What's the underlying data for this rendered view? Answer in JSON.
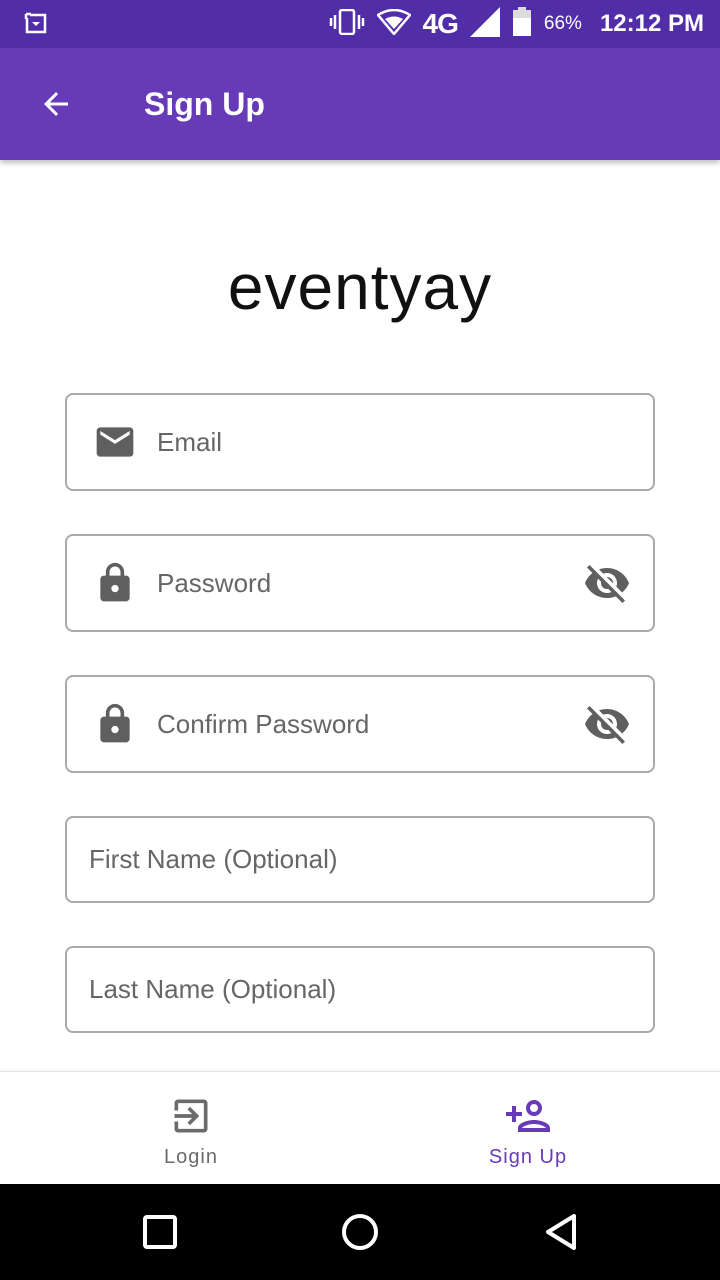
{
  "status_bar": {
    "network": "4G",
    "battery": "66%",
    "time": "12:12 PM"
  },
  "app_bar": {
    "title": "Sign Up",
    "back_icon": "arrow-back-icon"
  },
  "logo_text": "eventyay",
  "form": {
    "email": {
      "placeholder": "Email",
      "value": "",
      "icon": "mail-icon"
    },
    "password": {
      "placeholder": "Password",
      "value": "",
      "icon": "lock-icon",
      "toggle_icon": "visibility-off-icon"
    },
    "confirm_password": {
      "placeholder": "Confirm Password",
      "value": "",
      "icon": "lock-icon",
      "toggle_icon": "visibility-off-icon"
    },
    "first_name": {
      "placeholder": "First Name (Optional)",
      "value": ""
    },
    "last_name": {
      "placeholder": "Last Name (Optional)",
      "value": ""
    }
  },
  "bottom_nav": {
    "items": [
      {
        "label": "Login",
        "icon": "login-icon",
        "active": false
      },
      {
        "label": "Sign Up",
        "icon": "person-add-icon",
        "active": true
      }
    ]
  },
  "colors": {
    "status_bar": "#512da8",
    "app_bar": "#673ab7",
    "accent": "#673ab7",
    "icon_gray": "#5f5f5f"
  }
}
